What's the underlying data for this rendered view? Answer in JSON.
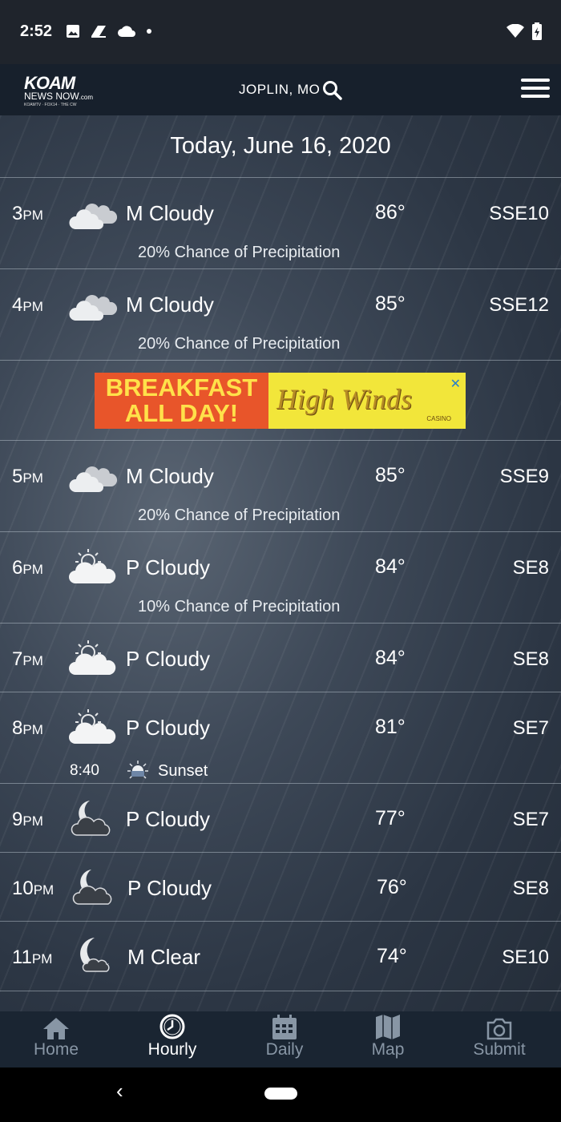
{
  "status_bar": {
    "time": "2:52"
  },
  "header": {
    "location": "JOPLIN, MO",
    "logo_main": "KOAM",
    "logo_sub": "NEWS NOW",
    "logo_com": ".com",
    "logo_tag": "KOAMTV · FOX14 · THE CW"
  },
  "date_title": "Today, June 16, 2020",
  "rows": [
    {
      "hour": "3",
      "ampm": "PM",
      "icon": "mostly-cloudy-icon",
      "condition": "M Cloudy",
      "temp": "86°",
      "wind": "SSE10",
      "precip": "20% Chance of Precipitation"
    },
    {
      "hour": "4",
      "ampm": "PM",
      "icon": "mostly-cloudy-icon",
      "condition": "M Cloudy",
      "temp": "85°",
      "wind": "SSE12",
      "precip": "20% Chance of Precipitation"
    },
    {
      "hour": "5",
      "ampm": "PM",
      "icon": "mostly-cloudy-icon",
      "condition": "M Cloudy",
      "temp": "85°",
      "wind": "SSE9",
      "precip": "20% Chance of Precipitation"
    },
    {
      "hour": "6",
      "ampm": "PM",
      "icon": "partly-cloudy-day-icon",
      "condition": "P Cloudy",
      "temp": "84°",
      "wind": "SE8",
      "precip": "10% Chance of Precipitation"
    },
    {
      "hour": "7",
      "ampm": "PM",
      "icon": "partly-cloudy-day-icon",
      "condition": "P Cloudy",
      "temp": "84°",
      "wind": "SE8"
    },
    {
      "hour": "8",
      "ampm": "PM",
      "icon": "partly-cloudy-day-icon",
      "condition": "P Cloudy",
      "temp": "81°",
      "wind": "SE7",
      "sunset_time": "8:40",
      "sunset_label": "Sunset"
    },
    {
      "hour": "9",
      "ampm": "PM",
      "icon": "partly-cloudy-night-icon",
      "condition": "P Cloudy",
      "temp": "77°",
      "wind": "SE7"
    },
    {
      "hour": "10",
      "ampm": "PM",
      "icon": "partly-cloudy-night-icon",
      "condition": "P Cloudy",
      "temp": "76°",
      "wind": "SE8"
    },
    {
      "hour": "11",
      "ampm": "PM",
      "icon": "mostly-clear-night-icon",
      "condition": "M Clear",
      "temp": "74°",
      "wind": "SE10"
    }
  ],
  "ad": {
    "left_line1": "BREAKFAST",
    "left_line2": "ALL DAY!",
    "brand": "High Winds",
    "brand_sub": "CASINO",
    "close": "✕"
  },
  "tabs": [
    {
      "label": "Home",
      "icon": "home-icon",
      "active": false
    },
    {
      "label": "Hourly",
      "icon": "clock-icon",
      "active": true
    },
    {
      "label": "Daily",
      "icon": "calendar-icon",
      "active": false
    },
    {
      "label": "Map",
      "icon": "map-icon",
      "active": false
    },
    {
      "label": "Submit",
      "icon": "camera-icon",
      "active": false
    }
  ],
  "colors": {
    "tab_active": "#ffffff",
    "tab_inactive": "#8896a5",
    "ad_orange": "#e8552a",
    "ad_yellow": "#f2e63a"
  }
}
